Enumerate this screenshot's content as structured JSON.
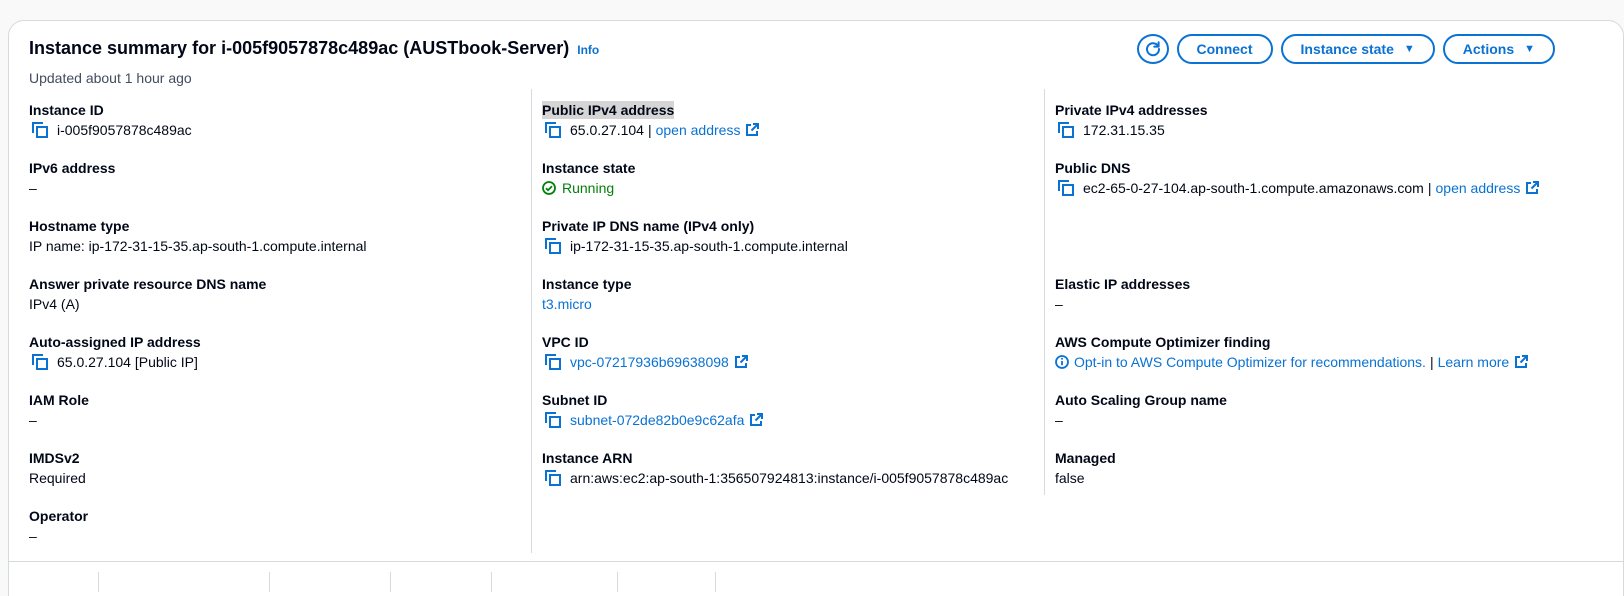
{
  "header": {
    "title": "Instance summary for i-005f9057878c489ac (AUSTbook-Server)",
    "info": "Info",
    "updated": "Updated about 1 hour ago",
    "buttons": {
      "refresh_icon": "refresh-icon",
      "connect": "Connect",
      "instance_state": "Instance state",
      "actions": "Actions"
    }
  },
  "col1": {
    "instance_id": {
      "label": "Instance ID",
      "value": "i-005f9057878c489ac"
    },
    "ipv6": {
      "label": "IPv6 address",
      "value": "–"
    },
    "hostname_type": {
      "label": "Hostname type",
      "value": "IP name: ip-172-31-15-35.ap-south-1.compute.internal"
    },
    "answer_dns": {
      "label": "Answer private resource DNS name",
      "value": "IPv4 (A)"
    },
    "auto_ip": {
      "label": "Auto-assigned IP address",
      "value": "65.0.27.104 [Public IP]"
    },
    "iam_role": {
      "label": "IAM Role",
      "value": "–"
    },
    "imdsv2": {
      "label": "IMDSv2",
      "value": "Required"
    },
    "operator": {
      "label": "Operator",
      "value": "–"
    }
  },
  "col2": {
    "public_ipv4": {
      "label": "Public IPv4 address",
      "value": "65.0.27.104",
      "sep": "|",
      "link": "open address"
    },
    "instance_state": {
      "label": "Instance state",
      "value": "Running"
    },
    "private_dns": {
      "label": "Private IP DNS name (IPv4 only)",
      "value": "ip-172-31-15-35.ap-south-1.compute.internal"
    },
    "instance_type": {
      "label": "Instance type",
      "value": "t3.micro"
    },
    "vpc_id": {
      "label": "VPC ID",
      "value": "vpc-07217936b69638098"
    },
    "subnet_id": {
      "label": "Subnet ID",
      "value": "subnet-072de82b0e9c62afa"
    },
    "instance_arn": {
      "label": "Instance ARN",
      "value": "arn:aws:ec2:ap-south-1:356507924813:instance/i-005f9057878c489ac"
    }
  },
  "col3": {
    "private_ipv4": {
      "label": "Private IPv4 addresses",
      "value": "172.31.15.35"
    },
    "public_dns": {
      "label": "Public DNS",
      "value": "ec2-65-0-27-104.ap-south-1.compute.amazonaws.com",
      "sep": "|",
      "link": "open address"
    },
    "elastic_ip": {
      "label": "Elastic IP addresses",
      "value": "–"
    },
    "optimizer": {
      "label": "AWS Compute Optimizer finding",
      "value": "Opt-in to AWS Compute Optimizer for recommendations.",
      "sep": "|",
      "link": "Learn more"
    },
    "asg": {
      "label": "Auto Scaling Group name",
      "value": "–"
    },
    "managed": {
      "label": "Managed",
      "value": "false"
    }
  },
  "colors": {
    "link": "#0972d3",
    "success": "#037f0c",
    "text": "#000716",
    "border": "#d5dbdb"
  }
}
